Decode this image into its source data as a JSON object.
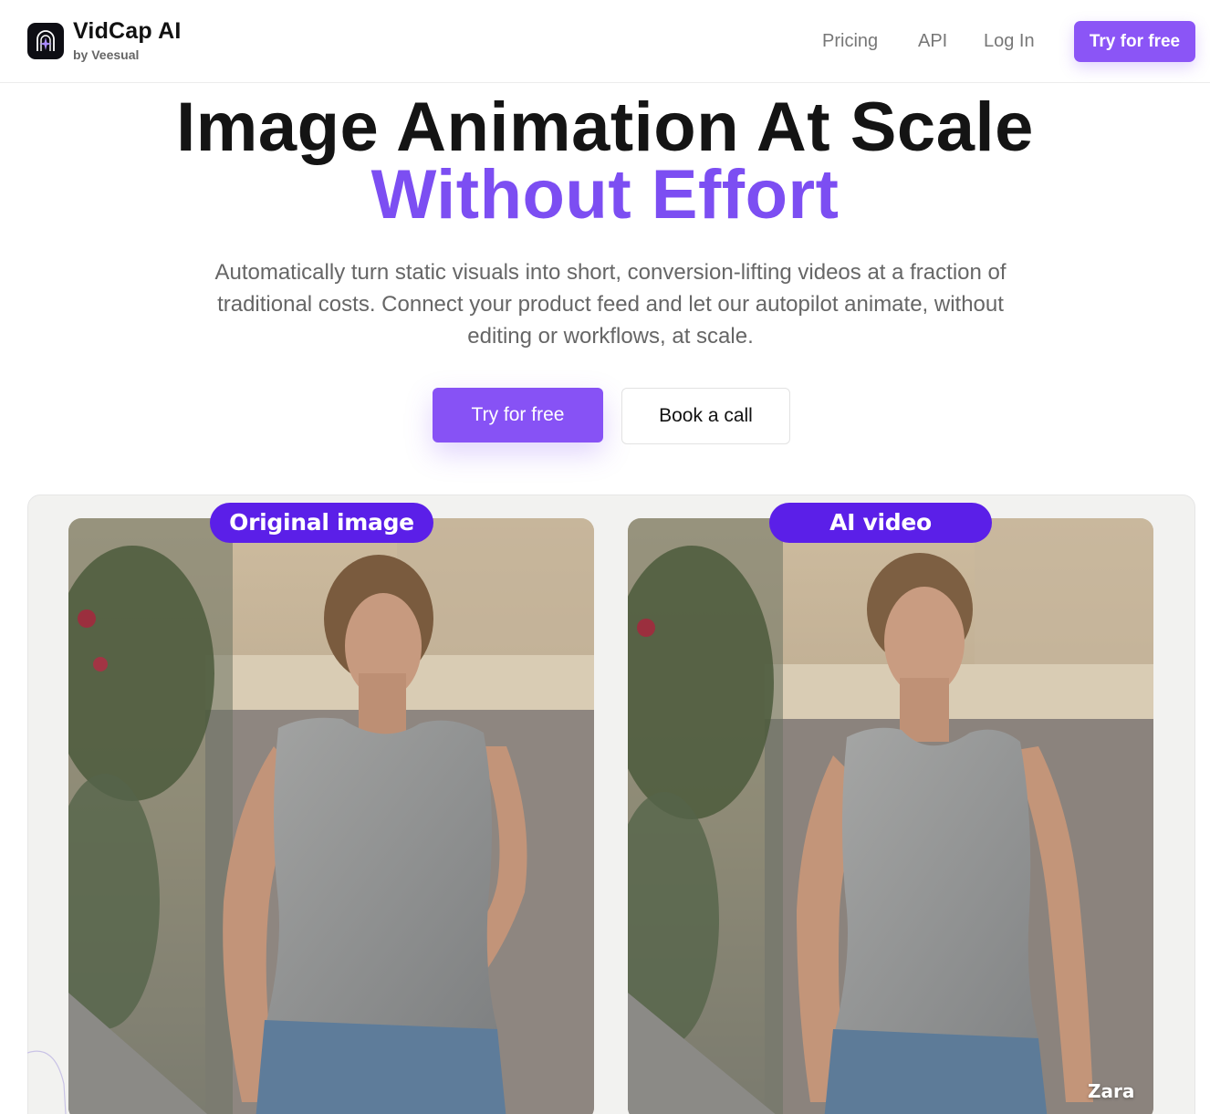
{
  "header": {
    "brand_name": "VidCap AI",
    "brand_sub": "by Veesual",
    "logo_icon": "arch-sparkle-icon",
    "nav": [
      "Pricing",
      "API",
      "Log In"
    ],
    "cta": "Try for free"
  },
  "hero": {
    "title_line1": "Image Animation At Scale",
    "title_line2": "Without Effort",
    "description": "Automatically turn static visuals into short, conversion-lifting videos at a fraction of traditional costs. Connect your product feed and let our autopilot animate, without editing or workflows, at scale.",
    "primary_button": "Try for free",
    "secondary_button": "Book a call"
  },
  "showcase": {
    "left_label": "Original image",
    "right_label": "AI video",
    "watermark": "Zara"
  },
  "colors": {
    "accent": "#8b55f6",
    "accent_text": "#7c4ef2",
    "pill": "#5b1fe8",
    "title": "#141414",
    "muted": "#666666"
  }
}
